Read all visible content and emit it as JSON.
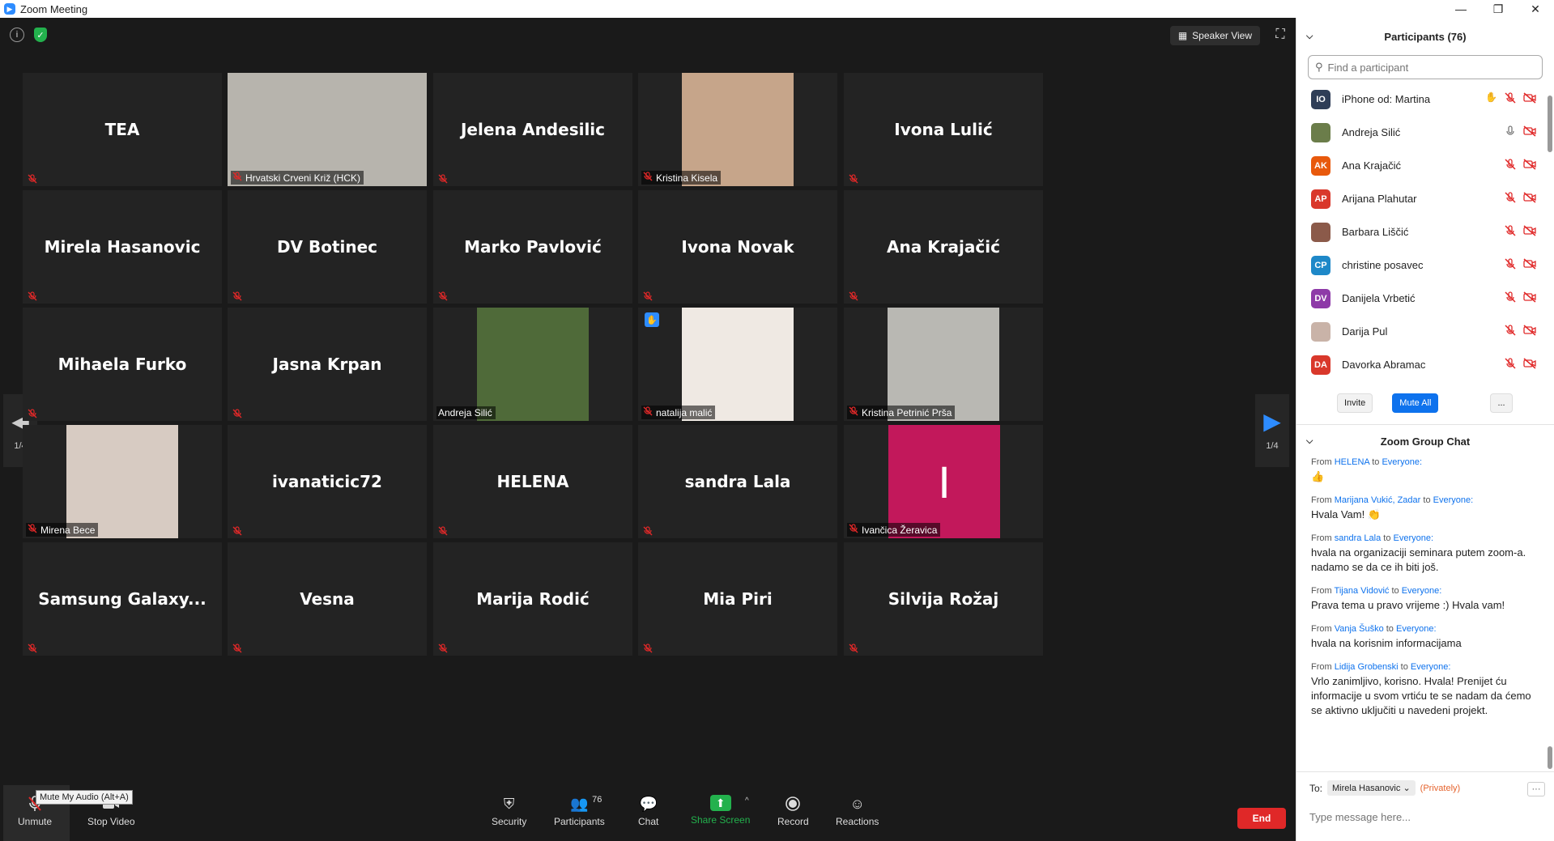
{
  "window": {
    "title": "Zoom Meeting",
    "app_icon": "zoom-icon",
    "min": "—",
    "restore": "❐",
    "close": "✕"
  },
  "top": {
    "speaker_view": "Speaker View",
    "info_icon": "i"
  },
  "nav": {
    "page": "1/4"
  },
  "tiles": [
    {
      "name": "TEA",
      "type": "name"
    },
    {
      "name": "Hrvatski Crveni Križ (HCK)",
      "type": "video",
      "active": true,
      "bg": "#b7b4ad"
    },
    {
      "name": "Jelena Andesilic",
      "type": "name"
    },
    {
      "name": "Kristina Kisela",
      "type": "video",
      "bg": "#c6a58a"
    },
    {
      "name": "Ivona Lulić",
      "type": "name"
    },
    {
      "name": "Mirela Hasanovic",
      "type": "name"
    },
    {
      "name": "DV Botinec",
      "type": "name"
    },
    {
      "name": "Marko Pavlović",
      "type": "name"
    },
    {
      "name": "Ivona Novak",
      "type": "name"
    },
    {
      "name": "Ana Krajačić",
      "type": "name"
    },
    {
      "name": "Mihaela Furko",
      "type": "name"
    },
    {
      "name": "Jasna Krpan",
      "type": "name"
    },
    {
      "name": "Andreja Silić",
      "type": "video",
      "bg": "#4f6a39",
      "nomute": true
    },
    {
      "name": "natalija malić",
      "type": "video",
      "bg": "#efe9e3",
      "hand": true
    },
    {
      "name": "Kristina Petrinić Prša",
      "type": "video",
      "bg": "#b9b8b3"
    },
    {
      "name": "Mirena Bece",
      "type": "video",
      "bg": "#d7cbc2"
    },
    {
      "name": "ivanaticic72",
      "type": "name"
    },
    {
      "name": "HELENA",
      "type": "name"
    },
    {
      "name": "sandra Lala",
      "type": "name"
    },
    {
      "name": "Ivančica Žeravica",
      "type": "initial",
      "initial": "I",
      "bg": "#c2185b"
    },
    {
      "name": "Samsung  Galaxy...",
      "type": "name"
    },
    {
      "name": "Vesna",
      "type": "name"
    },
    {
      "name": "Marija Rodić",
      "type": "name"
    },
    {
      "name": "Mia Piri",
      "type": "name"
    },
    {
      "name": "Silvija Rožaj",
      "type": "name"
    }
  ],
  "toolbar": {
    "unmute": "Unmute",
    "stop_video": "Stop Video",
    "tooltip": "Mute My Audio (Alt+A)",
    "security": "Security",
    "participants": "Participants",
    "participants_count": "76",
    "chat": "Chat",
    "share": "Share Screen",
    "record": "Record",
    "reactions": "Reactions",
    "end": "End"
  },
  "participants_panel": {
    "title": "Participants (76)",
    "search_placeholder": "Find a participant",
    "list": [
      {
        "initials": "IO",
        "name": "iPhone od: Martina",
        "color": "#2f3e57",
        "hand": true
      },
      {
        "initials": "",
        "name": "Andreja Silić",
        "color": "#6b7d4a",
        "mic_on": true
      },
      {
        "initials": "AK",
        "name": "Ana Krajačić",
        "color": "#e8590c"
      },
      {
        "initials": "AP",
        "name": "Arijana Plahutar",
        "color": "#d9382b"
      },
      {
        "initials": "",
        "name": "Barbara Liščić",
        "color": "#8b5a4a"
      },
      {
        "initials": "CP",
        "name": "christine posavec",
        "color": "#1e88c8"
      },
      {
        "initials": "DV",
        "name": "Danijela Vrbetić",
        "color": "#8e3aa8"
      },
      {
        "initials": "",
        "name": "Darija Pul",
        "color": "#c9b3a8"
      },
      {
        "initials": "DA",
        "name": "Davorka Abramac",
        "color": "#d9382b"
      }
    ],
    "invite": "Invite",
    "mute_all": "Mute All",
    "more": "..."
  },
  "chat_panel": {
    "title": "Zoom Group Chat",
    "from_word": "From",
    "to_word": "to",
    "messages": [
      {
        "from": "HELENA",
        "to": "Everyone:",
        "text": "👍"
      },
      {
        "from": "Marijana Vukić, Zadar",
        "to": "Everyone:",
        "text": "Hvala Vam! 👏"
      },
      {
        "from": "sandra Lala",
        "to": "Everyone:",
        "text": "hvala na organizaciji seminara putem zoom-a. nadamo se da ce ih biti još."
      },
      {
        "from": "Tijana Vidović",
        "to": "Everyone:",
        "text": "Prava tema u pravo vrijeme :) Hvala vam!"
      },
      {
        "from": "Vanja Šuško",
        "to": "Everyone:",
        "text": "hvala na korisnim informacijama"
      },
      {
        "from": "Lidija Grobenski",
        "to": "Everyone:",
        "text": "Vrlo zanimljivo, korisno. Hvala! Prenijet ću informacije u svom vrtiću te se nadam da ćemo se aktivno uključiti u navedeni projekt."
      }
    ],
    "to_label": "To:",
    "recipient": "Mirela Hasanovic",
    "privately": "(Privately)",
    "input_placeholder": "Type message here..."
  }
}
